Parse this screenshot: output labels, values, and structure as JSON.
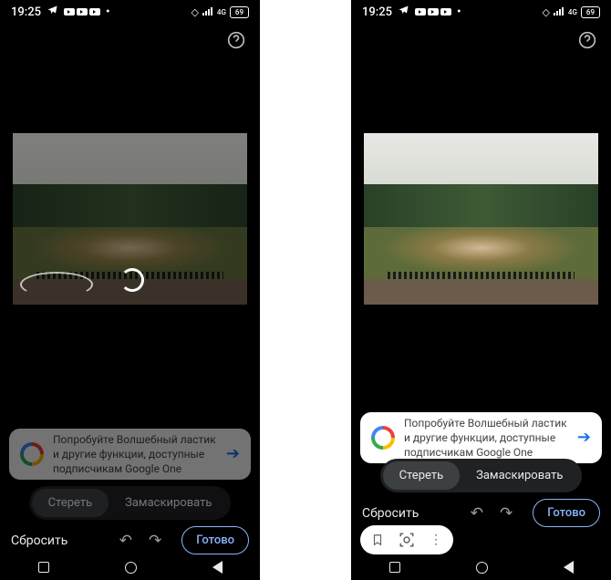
{
  "status": {
    "time": "19:25",
    "net_label": "4G",
    "battery": "69"
  },
  "promo": {
    "text": "Попробуйте Волшебный ластик и другие функции, доступные подписчикам Google One"
  },
  "segmented": {
    "erase": "Стереть",
    "mask": "Замаскировать"
  },
  "actions": {
    "reset": "Сбросить",
    "done": "Готово"
  }
}
